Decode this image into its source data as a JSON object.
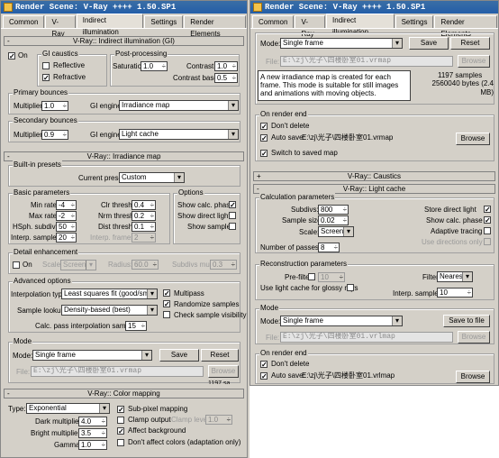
{
  "left": {
    "title": "Render Scene: V-Ray ++++ 1.50.SP1",
    "tabs": [
      "Common",
      "V-Ray",
      "Indirect illumination",
      "Settings",
      "Render Elements"
    ],
    "gi_rollout": {
      "title": "V-Ray:: Indirect illumination (GI)",
      "on_label": "On",
      "on_checked": true,
      "gi_caustics_group": "GI caustics",
      "reflective_label": "Reflective",
      "reflective_checked": false,
      "refractive_label": "Refractive",
      "refractive_checked": true,
      "postproc_group": "Post-processing",
      "saturation_label": "Saturation:",
      "saturation_value": "1.0",
      "contrast_label": "Contrast:",
      "contrast_value": "1.0",
      "contrast_base_label": "Contrast base:",
      "contrast_base_value": "0.5",
      "primary_group": "Primary bounces",
      "primary_multiplier_label": "Multiplier:",
      "primary_multiplier_value": "1.0",
      "primary_engine_label": "GI engine:",
      "primary_engine_value": "Irradiance map",
      "secondary_group": "Secondary bounces",
      "secondary_multiplier_label": "Multiplier:",
      "secondary_multiplier_value": "0.9",
      "secondary_engine_label": "GI engine:",
      "secondary_engine_value": "Light cache"
    },
    "irr_rollout": {
      "title": "V-Ray:: Irradiance map",
      "builtin_group": "Built-in presets",
      "current_preset_label": "Current preset:",
      "current_preset_value": "Custom",
      "basic_group": "Basic parameters",
      "min_rate_label": "Min rate:",
      "min_rate_value": "-4",
      "max_rate_label": "Max rate:",
      "max_rate_value": "-2",
      "hsph_label": "HSph. subdivs:",
      "hsph_value": "50",
      "interp_samples_label": "Interp. samples:",
      "interp_samples_value": "20",
      "clr_thresh_label": "Clr thresh:",
      "clr_thresh_value": "0.4",
      "nrm_thresh_label": "Nrm thresh:",
      "nrm_thresh_value": "0.2",
      "dist_thresh_label": "Dist thresh:",
      "dist_thresh_value": "0.1",
      "interp_frames_label": "Interp. frames:",
      "interp_frames_value": "2",
      "options_group": "Options",
      "show_calc_label": "Show calc. phase",
      "show_calc_checked": true,
      "show_direct_label": "Show direct light",
      "show_direct_checked": false,
      "show_samples_label": "Show samples",
      "show_samples_checked": false,
      "detail_group": "Detail enhancement",
      "detail_on_label": "On",
      "detail_on_checked": false,
      "scale_label": "Scale:",
      "scale_value": "Screen",
      "radius_label": "Radius:",
      "radius_value": "60.0",
      "subdivs_mult_label": "Subdivs mult.",
      "subdivs_mult_value": "0.3",
      "advanced_group": "Advanced options",
      "interp_type_label": "Interpolation type:",
      "interp_type_value": "Least squares fit (good/smooth",
      "multipass_label": "Multipass",
      "multipass_checked": true,
      "randomize_label": "Randomize samples",
      "randomize_checked": true,
      "check_vis_label": "Check sample visibility",
      "check_vis_checked": false,
      "sample_lookup_label": "Sample lookup:",
      "sample_lookup_value": "Density-based (best)",
      "calc_pass_label": "Calc. pass interpolation samples:",
      "calc_pass_value": "15",
      "mode_group": "Mode",
      "mode_label": "Mode:",
      "mode_value": "Single frame",
      "save_label": "Save",
      "reset_label": "Reset",
      "file_label": "File:",
      "file_value": "E:\\zj\\光子\\四楼卧室01.vrmap",
      "browse_label": "Browse",
      "partial_text": "1197 sa..."
    },
    "color_rollout": {
      "title": "V-Ray:: Color mapping",
      "type_label": "Type:",
      "type_value": "Exponential",
      "subpixel_label": "Sub-pixel mapping",
      "subpixel_checked": true,
      "clamp_output_label": "Clamp output",
      "clamp_output_checked": false,
      "clamp_level_label": "Clamp level:",
      "clamp_level_value": "1.0",
      "affect_bg_label": "Affect background",
      "affect_bg_checked": true,
      "dont_affect_label": "Don't affect colors (adaptation only)",
      "dont_affect_checked": false,
      "dark_mult_label": "Dark multiplier:",
      "dark_mult_value": "4.0",
      "bright_mult_label": "Bright multiplier:",
      "bright_mult_value": "3.5",
      "gamma_label": "Gamma:",
      "gamma_value": "1.0"
    }
  },
  "right": {
    "title": "Render Scene: V-Ray ++++ 1.50.SP1",
    "tabs": [
      "Common",
      "V-Ray",
      "Indirect illumination",
      "Settings",
      "Render Elements"
    ],
    "irr_mode": {
      "mode_label": "Mode:",
      "mode_value": "Single frame",
      "save_label": "Save",
      "reset_label": "Reset",
      "file_label": "File:",
      "file_value": "E:\\zj\\光子\\四楼卧室01.vrmap",
      "browse_label": "Browse",
      "desc": "A new irradiance map is created for each frame. This mode is suitable for still images and animations with moving objects.",
      "samples": "1197 samples",
      "bytes": "2560040 bytes (2.4 MB)"
    },
    "irr_render_end": {
      "group": "On render end",
      "dont_delete_label": "Don't delete",
      "dont_delete_checked": true,
      "auto_save_label": "Auto save:",
      "auto_save_checked": true,
      "auto_save_path": "E:\\zj\\光子\\四楼卧室01.vrmap",
      "browse_label": "Browse",
      "switch_label": "Switch to saved map",
      "switch_checked": true
    },
    "caustics_title": "V-Ray:: Caustics",
    "lc_rollout": {
      "title": "V-Ray:: Light cache",
      "calc_group": "Calculation parameters",
      "subdivs_label": "Subdivs:",
      "subdivs_value": "800",
      "sample_size_label": "Sample size:",
      "sample_size_value": "0.02",
      "scale_label": "Scale:",
      "scale_value": "Screen",
      "passes_label": "Number of passes:",
      "passes_value": "8",
      "store_direct_label": "Store direct light",
      "store_direct_checked": true,
      "show_calc_label": "Show calc. phase",
      "show_calc_checked": true,
      "adaptive_label": "Adaptive tracing",
      "adaptive_checked": false,
      "use_dirs_label": "Use directions only",
      "use_dirs_checked": false,
      "recon_group": "Reconstruction parameters",
      "prefilter_label": "Pre-filter:",
      "prefilter_checked": false,
      "prefilter_value": "10",
      "filter_label": "Filter:",
      "filter_value": "Nearest",
      "glossy_label": "Use light cache for glossy rays",
      "glossy_checked": false,
      "interp_label": "Interp. samples:",
      "interp_value": "10",
      "mode_group": "Mode",
      "mode_label": "Mode:",
      "mode_value": "Single frame",
      "save_label": "Save to file",
      "file_label": "File:",
      "file_value": "E:\\zj\\光子\\四楼卧室01.vrlmap",
      "browse_label": "Browse",
      "end_group": "On render end",
      "dont_delete_label": "Don't delete",
      "dont_delete_checked": true,
      "auto_save_label": "Auto save:",
      "auto_save_checked": true,
      "auto_save_path": "E:\\zj\\光子\\四楼卧室01.vrlmap",
      "auto_browse_label": "Browse"
    }
  }
}
